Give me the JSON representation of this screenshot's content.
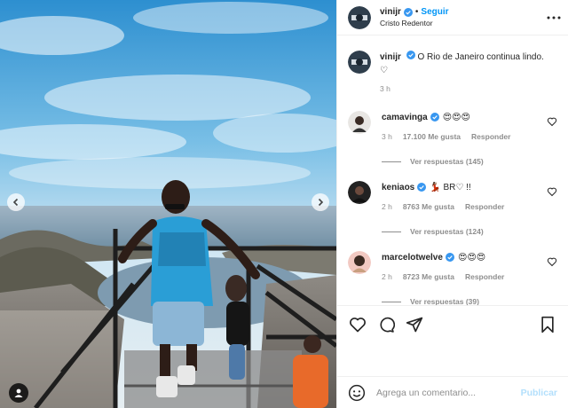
{
  "post": {
    "author": "vinijr",
    "follow_label": "Seguir",
    "separator": "•",
    "location": "Cristo Redentor",
    "caption_text": "O Rio de Janeiro continua lindo. ♡",
    "caption_time": "3 h"
  },
  "comments": [
    {
      "username": "camavinga",
      "text": "😍😍😍",
      "time": "3 h",
      "likes": "17.100 Me gusta",
      "reply_label": "Responder",
      "replies": "Ver respuestas (145)"
    },
    {
      "username": "keniaos",
      "text": "💃🏾 BR♡ !!",
      "time": "2 h",
      "likes": "8763 Me gusta",
      "reply_label": "Responder",
      "replies": "Ver respuestas (124)"
    },
    {
      "username": "marcelotwelve",
      "text": "😍😍😍",
      "time": "2 h",
      "likes": "8723 Me gusta",
      "reply_label": "Responder",
      "replies": "Ver respuestas (39)"
    }
  ],
  "composer": {
    "placeholder": "Agrega un comentario...",
    "publish_label": "Publicar"
  },
  "icons": {
    "verified": "verified-badge-icon",
    "more": "more-options-icon",
    "like": "heart-icon",
    "comment": "comment-bubble-icon",
    "share": "paper-plane-icon",
    "save": "bookmark-icon",
    "emoji": "emoji-icon",
    "tag": "user-tag-icon"
  },
  "colors": {
    "accent": "#0095f6",
    "verified": "#3897f0",
    "muted": "#8e8e8e",
    "publish_disabled": "#b2dffc"
  }
}
